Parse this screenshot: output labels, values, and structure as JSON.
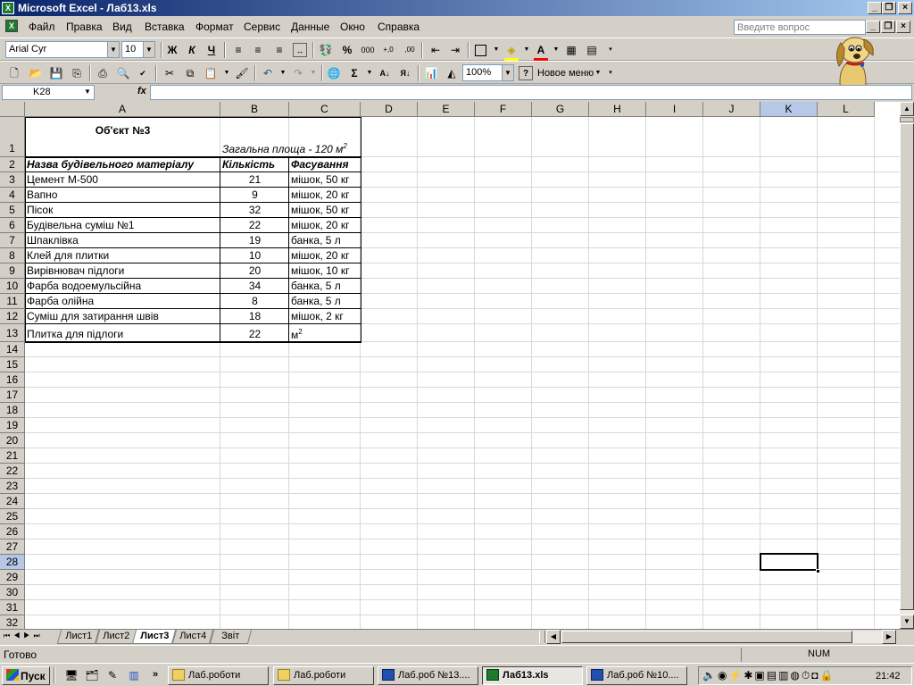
{
  "window": {
    "title": "Microsoft Excel - Лаб13.xls",
    "app_icon": "X"
  },
  "menu": {
    "items": [
      "Файл",
      "Правка",
      "Вид",
      "Вставка",
      "Формат",
      "Сервис",
      "Данные",
      "Окно",
      "Справка"
    ],
    "help_placeholder": "Введите вопрос"
  },
  "format_toolbar": {
    "font": "Arial Cyr",
    "size": "10",
    "bold": "Ж",
    "italic": "К",
    "underline": "Ч",
    "percent": "%",
    "thousands": "000",
    "inc_decimal": "+,0",
    "dec_decimal": ",00"
  },
  "standard_toolbar": {
    "zoom": "100%",
    "new_menu": "Новое меню",
    "sigma": "Σ"
  },
  "formula_bar": {
    "name_box": "K28",
    "fx": "fx"
  },
  "columns": [
    "A",
    "B",
    "C",
    "D",
    "E",
    "F",
    "G",
    "H",
    "I",
    "J",
    "K",
    "L"
  ],
  "rows": [
    "1",
    "2",
    "3",
    "4",
    "5",
    "6",
    "7",
    "8",
    "9",
    "10",
    "11",
    "12",
    "13",
    "14",
    "15",
    "16",
    "17",
    "18",
    "19",
    "20",
    "21",
    "22",
    "23",
    "24",
    "25",
    "26",
    "27",
    "28",
    "29",
    "30",
    "31",
    "32"
  ],
  "sheet": {
    "title": "Об'єкт №3",
    "area_label": "Загальна площа - 120 м",
    "area_sup": "2",
    "headers": [
      "Назва будівельного матеріалу",
      "Кількість",
      "Фасування"
    ],
    "table": [
      {
        "name": "Цемент М-500",
        "qty": "21",
        "pack": "мішок, 50 кг"
      },
      {
        "name": "Вапно",
        "qty": "9",
        "pack": "мішок, 20 кг"
      },
      {
        "name": "Пісок",
        "qty": "32",
        "pack": "мішок, 50 кг"
      },
      {
        "name": "Будівельна суміш №1",
        "qty": "22",
        "pack": "мішок, 20 кг"
      },
      {
        "name": "Шпаклівка",
        "qty": "19",
        "pack": "банка, 5 л"
      },
      {
        "name": "Клей для плитки",
        "qty": "10",
        "pack": "мішок, 20 кг"
      },
      {
        "name": "Вирівнювач підлоги",
        "qty": "20",
        "pack": "мішок, 10 кг"
      },
      {
        "name": "Фарба водоемульсійна",
        "qty": "34",
        "pack": "банка, 5 л"
      },
      {
        "name": "Фарба олійна",
        "qty": "8",
        "pack": "банка, 5 л"
      },
      {
        "name": "Суміш для затирання швів",
        "qty": "18",
        "pack": "мішок, 2 кг"
      },
      {
        "name": "Плитка для підлоги",
        "qty": "22",
        "pack": "м"
      }
    ],
    "last_pack_sup": "2"
  },
  "tabs": [
    "Лист1",
    "Лист2",
    "Лист3",
    "Лист4",
    "Звіт"
  ],
  "active_tab": "Лист3",
  "status": {
    "left": "Готово",
    "num": "NUM"
  },
  "taskbar": {
    "start": "Пуск",
    "tasks": [
      "Лаб.роботи",
      "Лаб.роботи",
      "Лаб.роб №13....",
      "Лаб13.xls",
      "Лаб.роб №10...."
    ],
    "clock": "21:42"
  },
  "colors": {
    "titlebar": "#0a246a",
    "excel_green": "#1d7a2e",
    "selection_header": "#b6c8e8"
  }
}
